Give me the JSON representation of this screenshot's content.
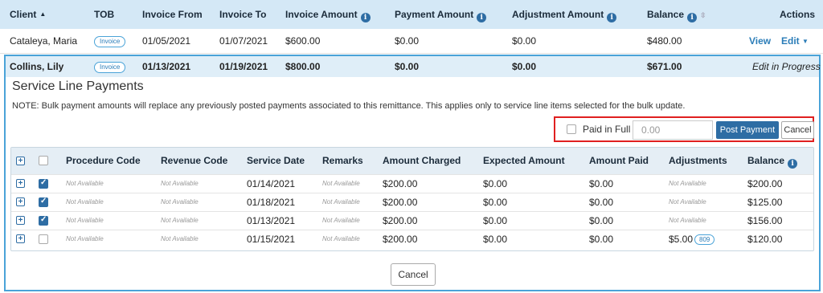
{
  "header": {
    "client": "Client",
    "tob": "TOB",
    "invoice_from": "Invoice From",
    "invoice_to": "Invoice To",
    "invoice_amount": "Invoice Amount",
    "payment_amount": "Payment Amount",
    "adjustment_amount": "Adjustment Amount",
    "balance": "Balance",
    "actions": "Actions"
  },
  "rows": [
    {
      "client": "Cataleya, Maria",
      "tob": "Invoice",
      "from": "01/05/2021",
      "to": "01/07/2021",
      "invoice_amount": "$600.00",
      "payment_amount": "$0.00",
      "adjustment_amount": "$0.00",
      "balance": "$480.00",
      "view": "View",
      "edit": "Edit"
    },
    {
      "client": "Collins, Lily",
      "tob": "Invoice",
      "from": "01/13/2021",
      "to": "01/19/2021",
      "invoice_amount": "$800.00",
      "payment_amount": "$0.00",
      "adjustment_amount": "$0.00",
      "balance": "$671.00",
      "status": "Edit in Progress"
    }
  ],
  "service_lines": {
    "title": "Service Line Payments",
    "note": "NOTE: Bulk payment amounts will replace any previously posted payments associated to this remittance. This applies only to service line items selected for the bulk update.",
    "paid_in_full_label": "Paid in Full",
    "amount_placeholder": "0.00",
    "post_payment": "Post Payment",
    "cancel_small": "Cancel",
    "columns": {
      "procedure_code": "Procedure Code",
      "revenue_code": "Revenue Code",
      "service_date": "Service Date",
      "remarks": "Remarks",
      "amount_charged": "Amount Charged",
      "expected_amount": "Expected Amount",
      "amount_paid": "Amount Paid",
      "adjustments": "Adjustments",
      "balance": "Balance"
    },
    "items": [
      {
        "checked": true,
        "procedure_code": "Not Available",
        "revenue_code": "Not Available",
        "service_date": "01/14/2021",
        "remarks": "Not Available",
        "amount_charged": "$200.00",
        "expected_amount": "$0.00",
        "amount_paid": "$0.00",
        "adjustments": "Not Available",
        "adjustment_code": "",
        "balance": "$200.00"
      },
      {
        "checked": true,
        "procedure_code": "Not Available",
        "revenue_code": "Not Available",
        "service_date": "01/18/2021",
        "remarks": "Not Available",
        "amount_charged": "$200.00",
        "expected_amount": "$0.00",
        "amount_paid": "$0.00",
        "adjustments": "Not Available",
        "adjustment_code": "",
        "balance": "$125.00"
      },
      {
        "checked": true,
        "procedure_code": "Not Available",
        "revenue_code": "Not Available",
        "service_date": "01/13/2021",
        "remarks": "Not Available",
        "amount_charged": "$200.00",
        "expected_amount": "$0.00",
        "amount_paid": "$0.00",
        "adjustments": "Not Available",
        "adjustment_code": "",
        "balance": "$156.00"
      },
      {
        "checked": false,
        "procedure_code": "Not Available",
        "revenue_code": "Not Available",
        "service_date": "01/15/2021",
        "remarks": "Not Available",
        "amount_charged": "$200.00",
        "expected_amount": "$0.00",
        "amount_paid": "$0.00",
        "adjustments": "$5.00",
        "adjustment_code": "809",
        "balance": "$120.00"
      }
    ],
    "cancel": "Cancel"
  }
}
